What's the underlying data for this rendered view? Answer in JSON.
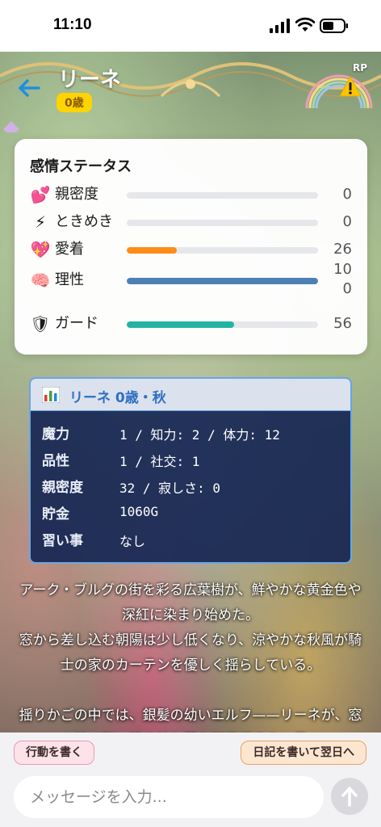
{
  "status_bar": {
    "time": "11:10"
  },
  "header": {
    "name": "リーネ",
    "age_badge": "0歳",
    "mode_label": "RP"
  },
  "emotion_card": {
    "title": "感情ステータス",
    "stats": [
      {
        "emoji": "💕",
        "label": "親密度",
        "value": "0",
        "level": 0,
        "color": "#f0a030"
      },
      {
        "emoji": "⚡",
        "label": "ときめき",
        "value": "0",
        "level": 0,
        "color": "#f0a030"
      },
      {
        "emoji": "💖",
        "label": "愛着",
        "value": "26",
        "level": 0.26,
        "color": "#ff8c1a"
      },
      {
        "emoji": "🧠",
        "label": "理性",
        "value": "10\n0",
        "level": 1.0,
        "color": "#4f80b4"
      },
      {
        "emoji": "🛡",
        "label": "ガード",
        "value": "56",
        "level": 0.56,
        "color": "#23b3a3"
      }
    ]
  },
  "info_panel": {
    "title": "リーネ 0歳・秋",
    "rows": [
      {
        "key": "魔力",
        "value": "1 / 知力: 2 / 体力: 12"
      },
      {
        "key": "品性",
        "value": "1 / 社交: 1"
      },
      {
        "key": "親密度",
        "value": "32 / 寂しさ: 0"
      },
      {
        "key": "貯金",
        "value": "1060G"
      },
      {
        "key": "習い事",
        "value": "なし"
      }
    ]
  },
  "story": {
    "paragraphs": [
      "アーク・ブルグの街を彩る広葉樹が、鮮やかな黄金色や深紅に染まり始めた。\n窓から差し込む朝陽は少し低くなり、涼やかな秋風が騎士の家のカーテンを優しく揺らしている。",
      "揺りかごの中では、銀髪の幼いエルフ——リーネが、窓の外で舞い踊る枯れ葉を不思議そうに見つ"
    ]
  },
  "bottom_bar": {
    "action_button": "行動を書く",
    "diary_button": "日記を書いて翌日へ",
    "message_placeholder": "メッセージを入力..."
  },
  "colors": {
    "badge": "#ffd400",
    "panel_bg": "#162654",
    "panel_border": "#6aa6e6",
    "info_title": "#2f6fc4"
  }
}
